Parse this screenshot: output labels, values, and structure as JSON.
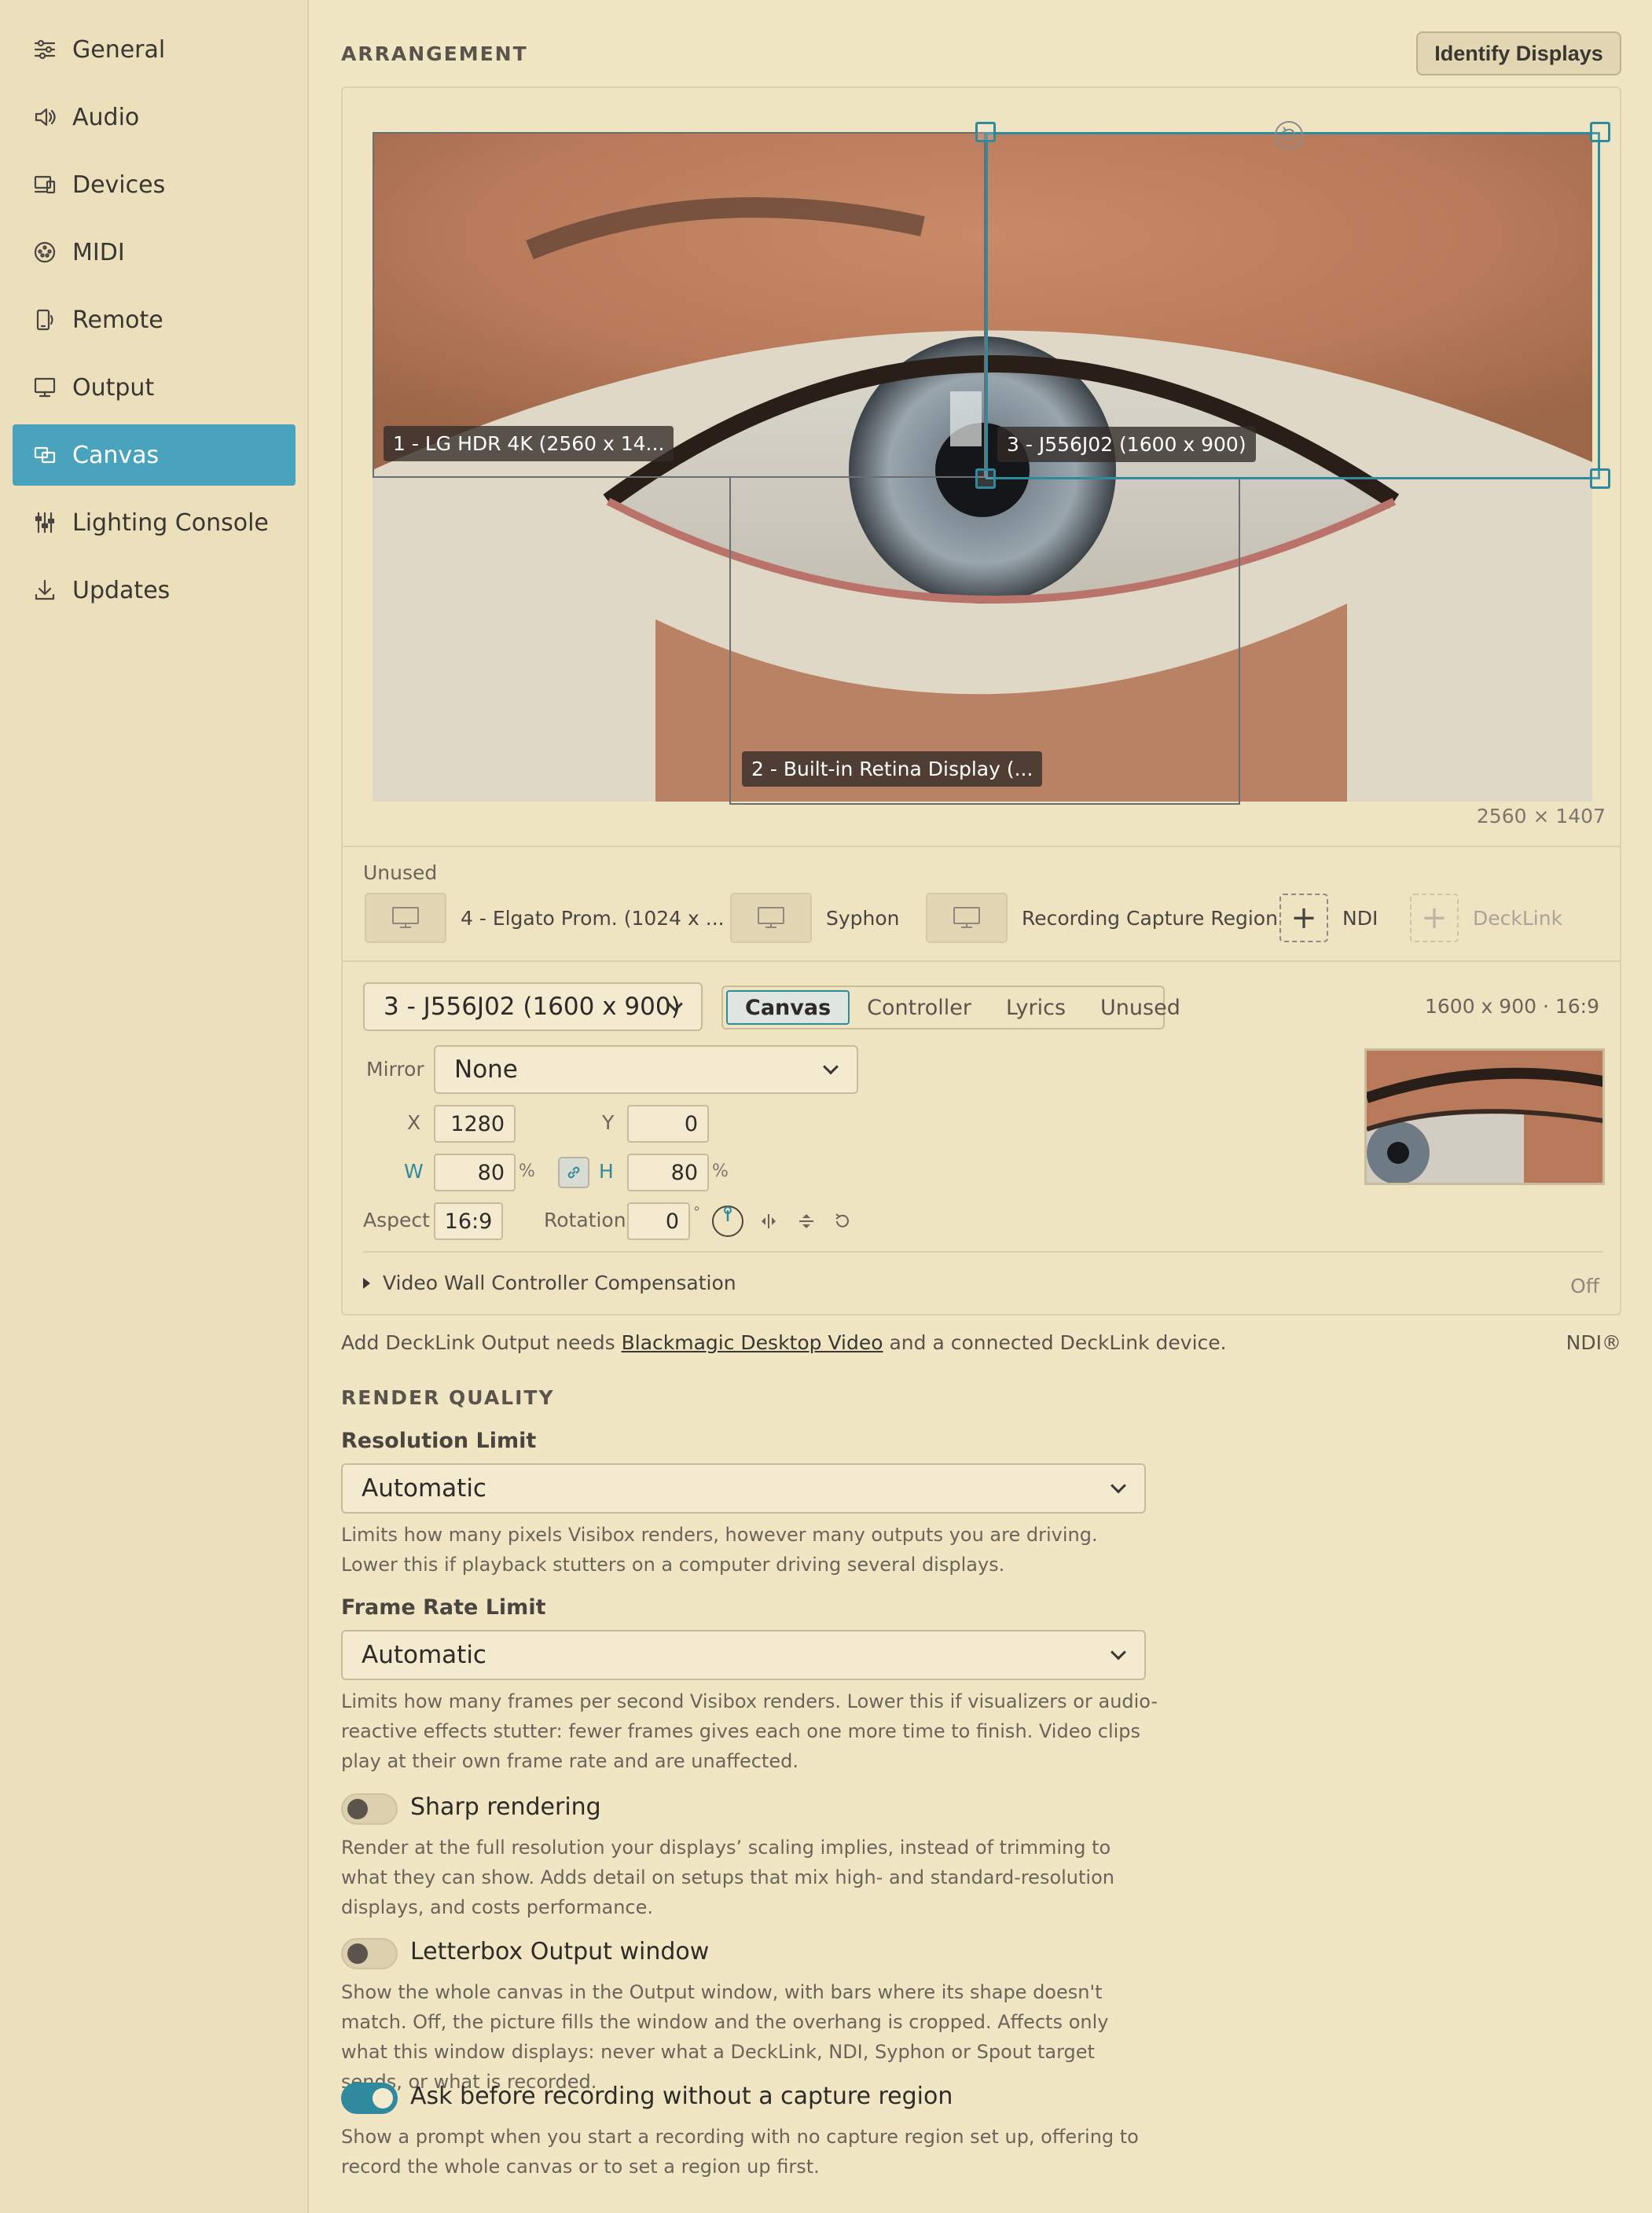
{
  "sidebar": {
    "items": [
      {
        "label": "General",
        "icon": "sliders-icon"
      },
      {
        "label": "Audio",
        "icon": "speaker-icon"
      },
      {
        "label": "Devices",
        "icon": "devices-icon"
      },
      {
        "label": "MIDI",
        "icon": "midi-icon"
      },
      {
        "label": "Remote",
        "icon": "remote-icon"
      },
      {
        "label": "Output",
        "icon": "monitor-icon"
      },
      {
        "label": "Canvas",
        "icon": "canvas-icon",
        "active": true
      },
      {
        "label": "Lighting Console",
        "icon": "mixer-icon"
      },
      {
        "label": "Updates",
        "icon": "download-icon"
      }
    ]
  },
  "arrangement": {
    "title": "ARRANGEMENT",
    "identify_button": "Identify Displays",
    "displays": [
      {
        "label": "1 - LG HDR 4K (2560 x 14..."
      },
      {
        "label": "2 - Built-in Retina Display (..."
      },
      {
        "label": "3 - J556J02 (1600 x 900)",
        "selected": true
      }
    ],
    "canvas_size": "2560 × 1407",
    "unused_label": "Unused",
    "unused_items": [
      {
        "label": "4 - Elgato Prom. (1024 x ...",
        "kind": "monitor"
      },
      {
        "label": "Syphon",
        "kind": "monitor"
      },
      {
        "label": "Recording Capture Region",
        "kind": "monitor"
      },
      {
        "label": "NDI",
        "kind": "add"
      },
      {
        "label": "DeckLink",
        "kind": "add",
        "disabled": true
      }
    ]
  },
  "editor": {
    "display_select": "3 - J556J02 (1600 x 900)",
    "tabs": [
      "Canvas",
      "Controller",
      "Lyrics",
      "Unused"
    ],
    "active_tab": "Canvas",
    "summary": "1600 x 900 · 16:9",
    "mirror_label": "Mirror",
    "mirror_value": "None",
    "x_label": "X",
    "x_value": "1280",
    "y_label": "Y",
    "y_value": "0",
    "w_label": "W",
    "w_value": "80",
    "h_label": "H",
    "h_value": "80",
    "percent": "%",
    "aspect_label": "Aspect",
    "aspect_value": "16:9",
    "rotation_label": "Rotation",
    "rotation_value": "0",
    "degree": "°",
    "video_wall_label": "Video Wall Controller Compensation",
    "video_wall_status": "Off"
  },
  "decklink_note": {
    "prefix": "Add DeckLink Output needs ",
    "link": "Blackmagic Desktop Video",
    "suffix": " and a connected DeckLink device.",
    "ndi": "NDI®"
  },
  "render_quality": {
    "title": "RENDER QUALITY",
    "resolution_label": "Resolution Limit",
    "resolution_value": "Automatic",
    "resolution_help": "Limits how many pixels Visibox renders, however many outputs you are driving. Lower this if playback stutters on a computer driving several displays.",
    "framerate_label": "Frame Rate Limit",
    "framerate_value": "Automatic",
    "framerate_help": "Limits how many frames per second Visibox renders. Lower this if visualizers or audio-reactive effects stutter: fewer frames gives each one more time to finish. Video clips play at their own frame rate and are unaffected.",
    "toggles": [
      {
        "label": "Sharp rendering",
        "on": false,
        "help": "Render at the full resolution your displays’ scaling implies, instead of trimming to what they can show. Adds detail on setups that mix high- and standard-resolution displays, and costs performance."
      },
      {
        "label": "Letterbox Output window",
        "on": false,
        "help": "Show the whole canvas in the Output window, with bars where its shape doesn't match. Off, the picture fills the window and the overhang is cropped. Affects only what this window displays: never what a DeckLink, NDI, Syphon or Spout target sends, or what is recorded."
      },
      {
        "label": "Ask before recording without a capture region",
        "on": true,
        "help": "Show a prompt when you start a recording with no capture region set up, offering to record the whole canvas or to set a region up first."
      }
    ]
  },
  "colors": {
    "accent": "#4aa3bd",
    "selection": "#2f8a9e",
    "background": "#f1e6c4"
  }
}
